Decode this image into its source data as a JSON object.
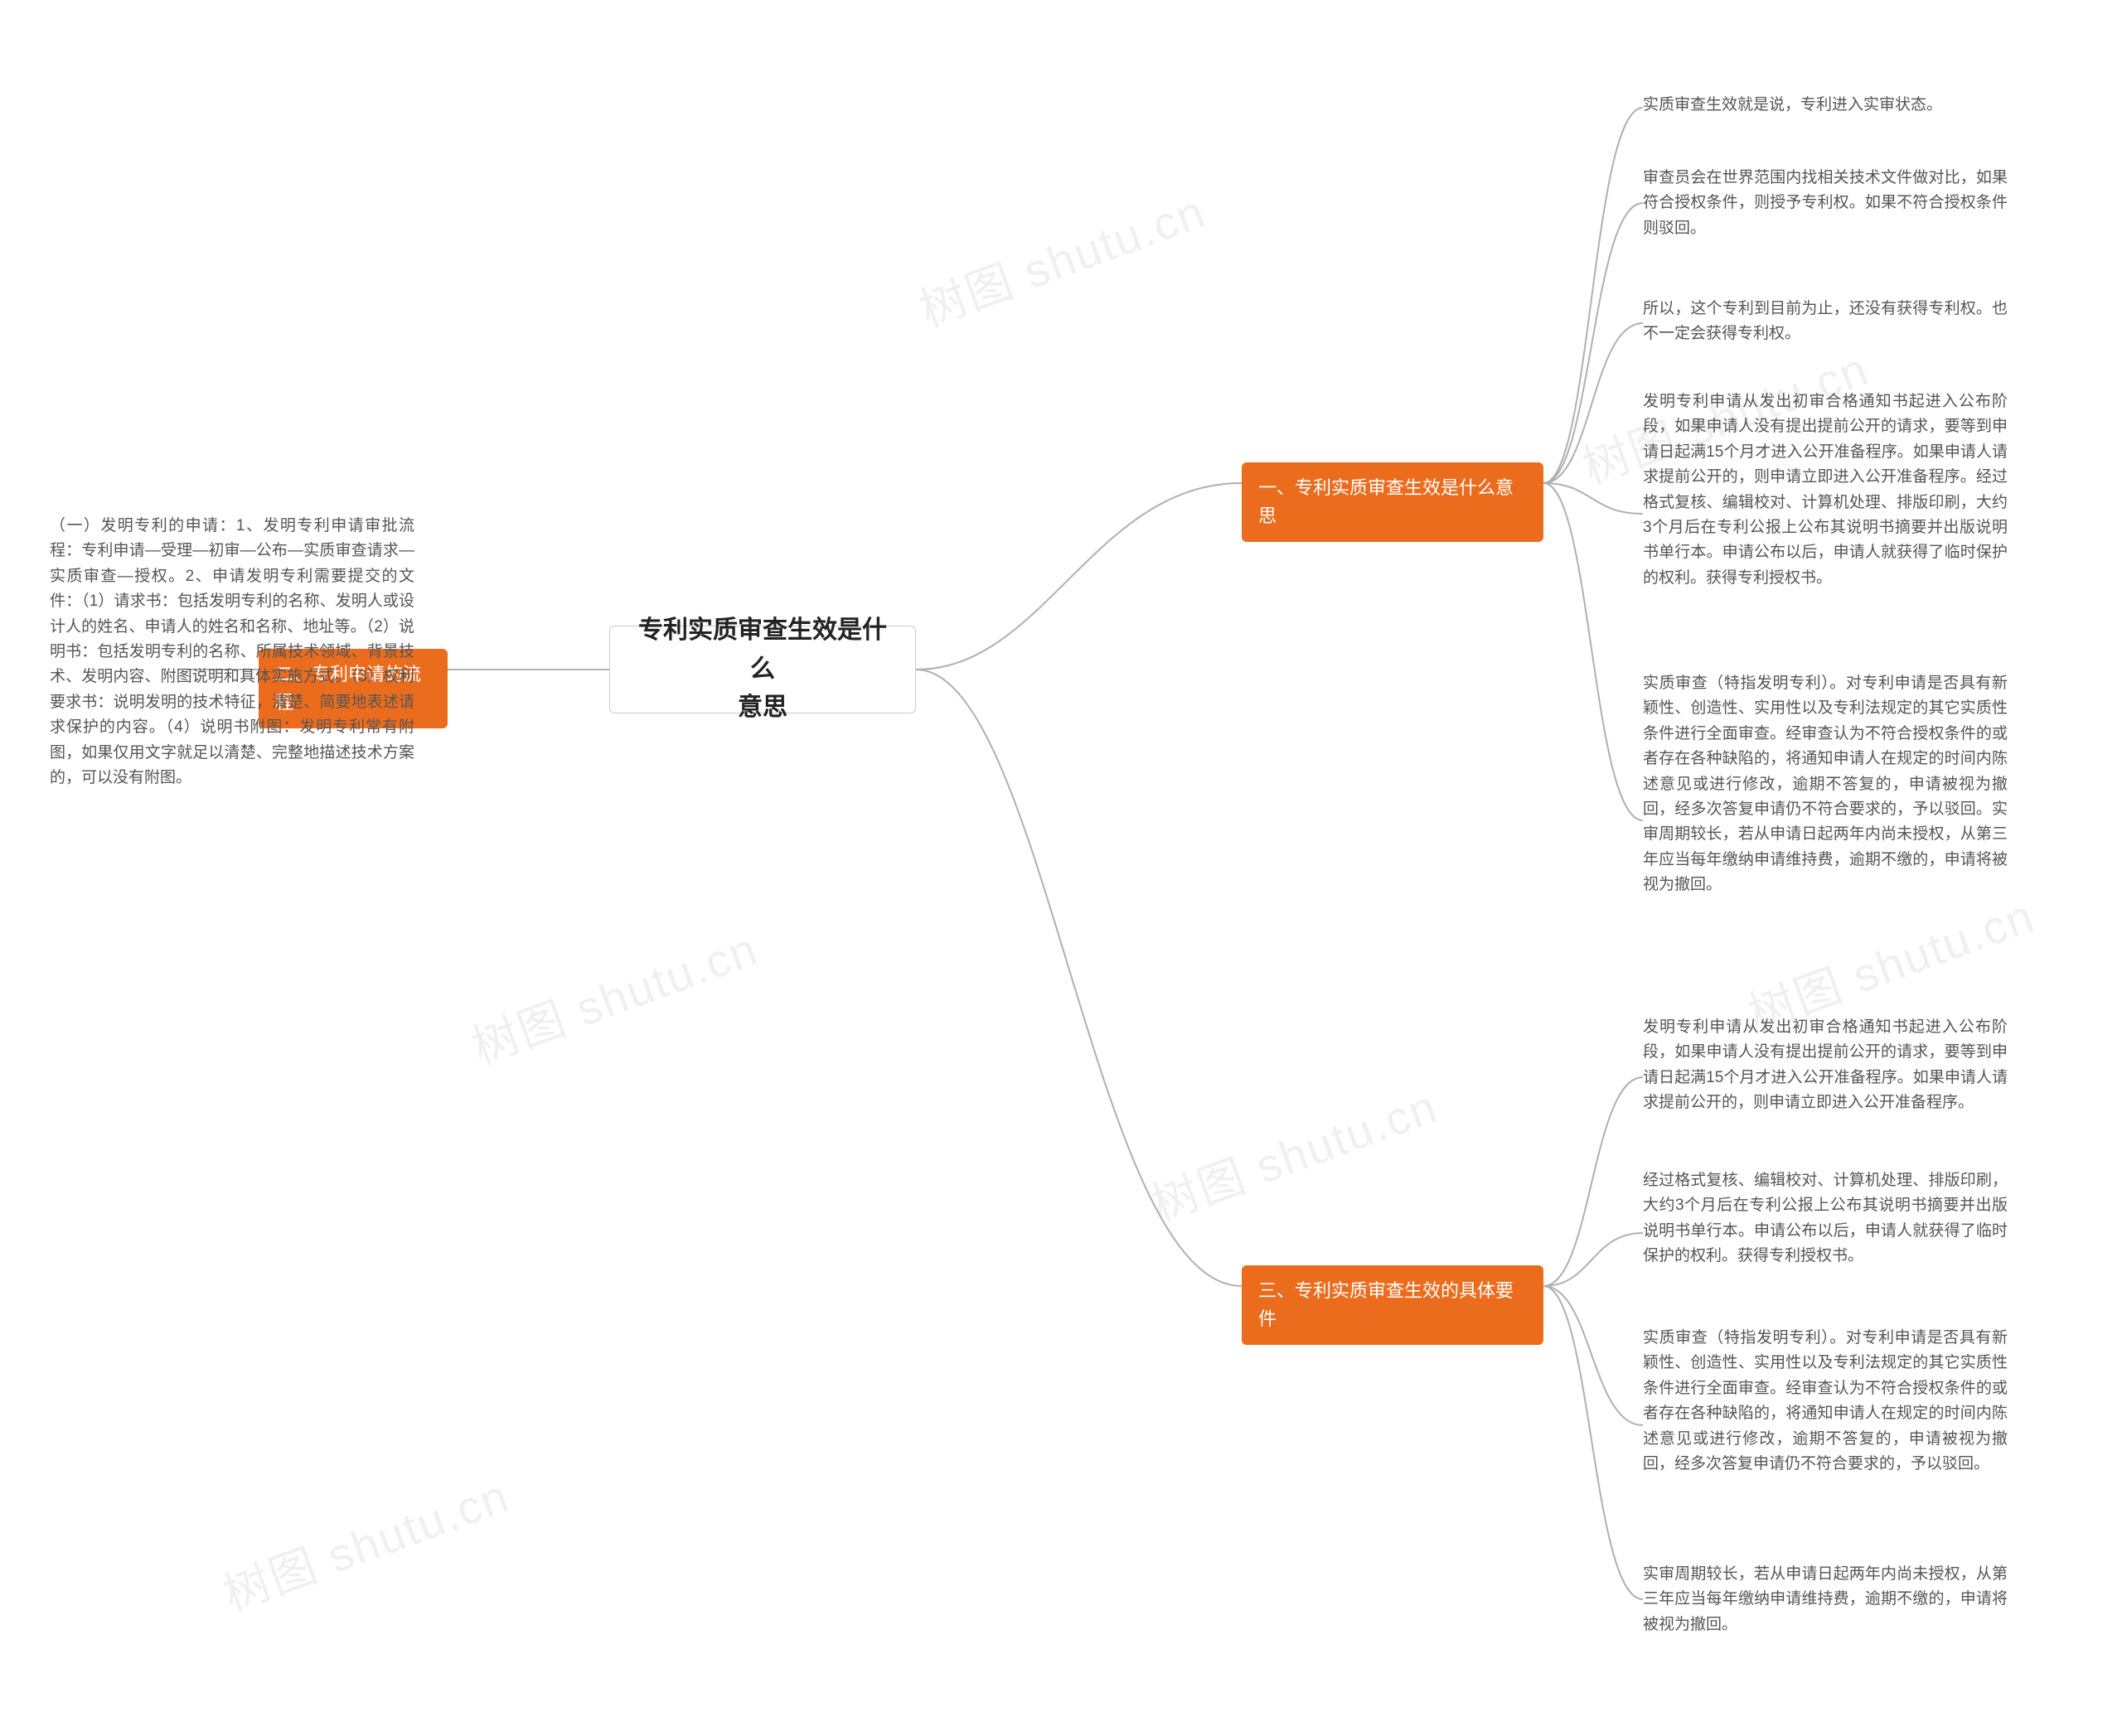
{
  "watermark": "树图 shutu.cn",
  "root": {
    "title_line1": "专利实质审查生效是什么",
    "title_line2": "意思"
  },
  "branch1": {
    "label": "一、专利实质审查生效是什么意思",
    "leaves": [
      "实质审查生效就是说，专利进入实审状态。",
      "审查员会在世界范围内找相关技术文件做对比，如果符合授权条件，则授予专利权。如果不符合授权条件则驳回。",
      "所以，这个专利到目前为止，还没有获得专利权。也不一定会获得专利权。",
      "发明专利申请从发出初审合格通知书起进入公布阶段，如果申请人没有提出提前公开的请求，要等到申请日起满15个月才进入公开准备程序。如果申请人请求提前公开的，则申请立即进入公开准备程序。经过格式复核、编辑校对、计算机处理、排版印刷，大约3个月后在专利公报上公布其说明书摘要并出版说明书单行本。申请公布以后，申请人就获得了临时保护的权利。获得专利授权书。",
      "实质审查（特指发明专利）。对专利申请是否具有新颖性、创造性、实用性以及专利法规定的其它实质性条件进行全面审查。经审查认为不符合授权条件的或者存在各种缺陷的，将通知申请人在规定的时间内陈述意见或进行修改，逾期不答复的，申请被视为撤回，经多次答复申请仍不符合要求的，予以驳回。实审周期较长，若从申请日起两年内尚未授权，从第三年应当每年缴纳申请维持费，逾期不缴的，申请将被视为撤回。"
    ]
  },
  "branch2": {
    "label": "二、专利申请的流程",
    "leaf": "（一）发明专利的申请：1、发明专利申请审批流程：专利申请—受理—初审—公布—实质审查请求—实质审查—授权。2、申请发明专利需要提交的文件：（1）请求书：包括发明专利的名称、发明人或设计人的姓名、申请人的姓名和名称、地址等。（2）说明书：包括发明专利的名称、所属技术领域、背景技术、发明内容、附图说明和具体实施方式。（3）权利要求书：说明发明的技术特征，清楚、简要地表述请求保护的内容。（4）说明书附图：发明专利常有附图，如果仅用文字就足以清楚、完整地描述技术方案的，可以没有附图。"
  },
  "branch3": {
    "label": "三、专利实质审查生效的具体要件",
    "leaves": [
      "发明专利申请从发出初审合格通知书起进入公布阶段，如果申请人没有提出提前公开的请求，要等到申请日起满15个月才进入公开准备程序。如果申请人请求提前公开的，则申请立即进入公开准备程序。",
      "经过格式复核、编辑校对、计算机处理、排版印刷，大约3个月后在专利公报上公布其说明书摘要并出版说明书单行本。申请公布以后，申请人就获得了临时保护的权利。获得专利授权书。",
      "实质审查（特指发明专利）。对专利申请是否具有新颖性、创造性、实用性以及专利法规定的其它实质性条件进行全面审查。经审查认为不符合授权条件的或者存在各种缺陷的，将通知申请人在规定的时间内陈述意见或进行修改，逾期不答复的，申请被视为撤回，经多次答复申请仍不符合要求的，予以驳回。",
      "实审周期较长，若从申请日起两年内尚未授权，从第三年应当每年缴纳申请维持费，逾期不缴的，申请将被视为撤回。"
    ]
  }
}
